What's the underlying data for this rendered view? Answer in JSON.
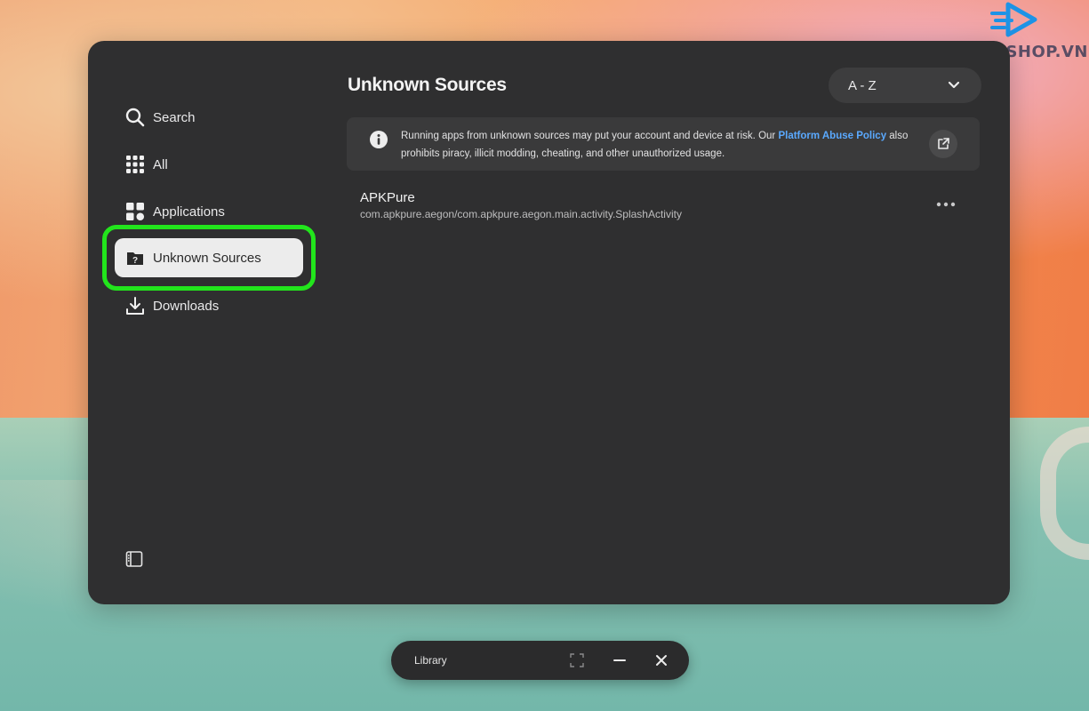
{
  "watermark": {
    "text": "DROID SHOP.VN"
  },
  "sidebar": {
    "items": [
      {
        "label": "Search",
        "icon": "search-icon"
      },
      {
        "label": "All",
        "icon": "grid-icon"
      },
      {
        "label": "Applications",
        "icon": "apps-icon"
      },
      {
        "label": "Unknown Sources",
        "icon": "unknown-source-icon",
        "active": true
      },
      {
        "label": "Downloads",
        "icon": "download-icon"
      }
    ],
    "panel_toggle_icon": "sidebar-toggle-icon"
  },
  "main": {
    "title": "Unknown Sources",
    "sort": {
      "value": "A - Z"
    },
    "banner": {
      "text_before": "Running apps from unknown sources may put your account and device at risk. Our ",
      "link": "Platform Abuse Policy",
      "text_after": " also prohibits piracy, illicit modding, cheating, and other unauthorized usage."
    },
    "apps": [
      {
        "name": "APKPure",
        "package": "com.apkpure.aegon/com.apkpure.aegon.main.activity.SplashActivity"
      }
    ]
  },
  "taskbar": {
    "label": "Library"
  },
  "colors": {
    "highlight": "#22e51c",
    "link": "#5aa9ff",
    "panel": "#2f2f30"
  }
}
